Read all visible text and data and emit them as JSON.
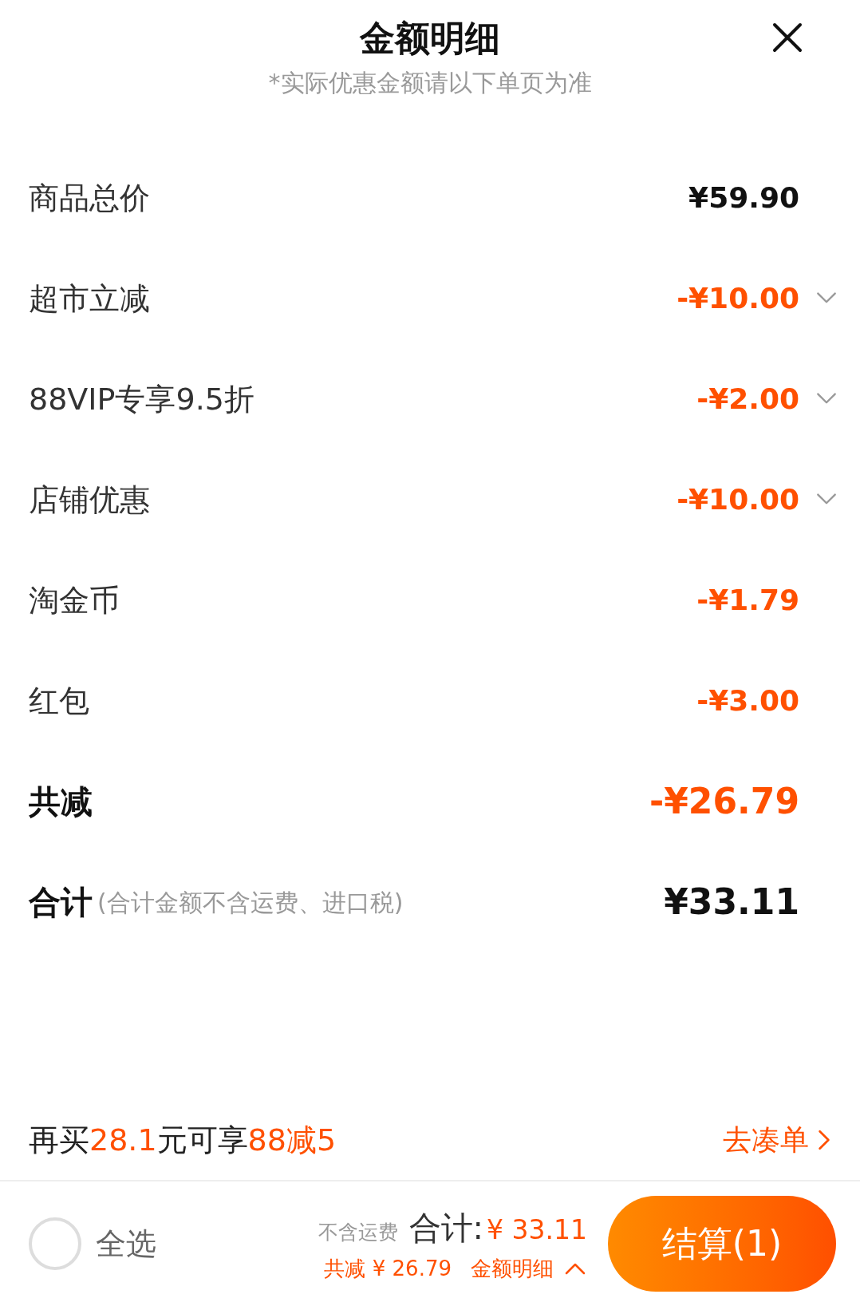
{
  "header": {
    "title": "金额明细",
    "subtitle": "*实际优惠金额请以下单页为准"
  },
  "rows": [
    {
      "kind": "item",
      "label": "商品总价",
      "value": "¥59.90",
      "discount": false,
      "expandable": false
    },
    {
      "kind": "item",
      "label": "超市立减",
      "value": "-¥10.00",
      "discount": true,
      "expandable": true
    },
    {
      "kind": "item",
      "label": "88VIP专享9.5折",
      "value": "-¥2.00",
      "discount": true,
      "expandable": true
    },
    {
      "kind": "item",
      "label": "店铺优惠",
      "value": "-¥10.00",
      "discount": true,
      "expandable": true
    },
    {
      "kind": "item",
      "label": "淘金币",
      "value": "-¥1.79",
      "discount": true,
      "expandable": false
    },
    {
      "kind": "item",
      "label": "红包",
      "value": "-¥3.00",
      "discount": true,
      "expandable": false
    },
    {
      "kind": "total",
      "label": "共减",
      "value": "-¥26.79",
      "discount": true,
      "expandable": false
    },
    {
      "kind": "total",
      "label": "合计",
      "note": "(合计金额不含运费、进口税)",
      "value": "¥33.11",
      "discount": false,
      "expandable": false
    }
  ],
  "promo": {
    "parts": [
      {
        "text": "再买",
        "highlight": false
      },
      {
        "text": "28.1",
        "highlight": true
      },
      {
        "text": "元可享",
        "highlight": false
      },
      {
        "text": "88减5",
        "highlight": true
      }
    ],
    "link": "去凑单"
  },
  "bottom_bar": {
    "select_all": {
      "label": "全选",
      "checked": false
    },
    "shipping_note": "不含运费",
    "total_label": "合计:",
    "total_value": "¥ 33.11",
    "saved": "共减 ¥ 26.79",
    "details_link": "金额明细",
    "details_expanded": true,
    "checkout_button": "结算(1)"
  }
}
